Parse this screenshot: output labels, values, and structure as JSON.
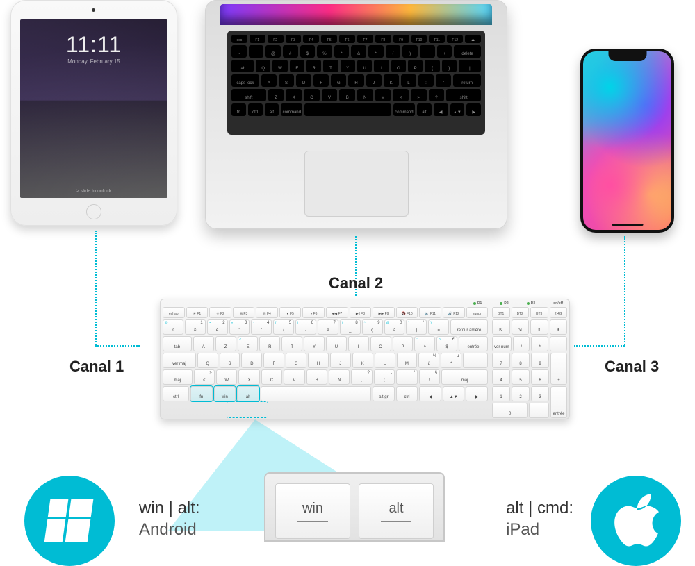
{
  "ipad": {
    "time": "11:11",
    "date": "Monday, February 15",
    "unlock": "> slide to unlock"
  },
  "macbook": {
    "keys_fn": [
      "esc",
      "F1",
      "F2",
      "F3",
      "F4",
      "F5",
      "F6",
      "F7",
      "F8",
      "F9",
      "F10",
      "F11",
      "F12",
      "⏏"
    ],
    "rows": {
      "num": [
        "~",
        "!",
        "@",
        "#",
        "$",
        "%",
        "^",
        "&",
        "*",
        "(",
        ")",
        "_",
        "+",
        "delete"
      ],
      "q": [
        "tab",
        "Q",
        "W",
        "E",
        "R",
        "T",
        "Y",
        "U",
        "I",
        "O",
        "P",
        "{",
        "}",
        "|"
      ],
      "a": [
        "caps lock",
        "A",
        "S",
        "D",
        "F",
        "G",
        "H",
        "J",
        "K",
        "L",
        ":",
        "\"",
        "return"
      ],
      "z": [
        "shift",
        "Z",
        "X",
        "C",
        "V",
        "B",
        "N",
        "M",
        "<",
        ">",
        "?",
        "shift"
      ],
      "sp": [
        "fn",
        "ctrl",
        "alt",
        "command",
        "",
        "command",
        "alt",
        "◀",
        "▲▼",
        "▶"
      ]
    }
  },
  "labels": {
    "c1": "Canal 1",
    "c2": "Canal 2",
    "c3": "Canal 3"
  },
  "white_kb": {
    "status": [
      "D1",
      "D2",
      "D3",
      "on/off"
    ],
    "fn": [
      "échap",
      "☀ F1",
      "☀ F2",
      "⊞ F3",
      "⊟ F4",
      "◐ F5",
      "◑ F6",
      "◀◀ F7",
      "▶‖ F8",
      "▶▶ F9",
      "🔇 F10",
      "🔉 F11",
      "🔊 F12",
      "suppr",
      "BT1",
      "BT2",
      "BT3",
      "2.4G"
    ],
    "r1": [
      {
        "t": "²",
        "s": "@"
      },
      {
        "t": "&",
        "n": "1"
      },
      {
        "t": "é",
        "n": "2",
        "s": "~"
      },
      {
        "t": "\"",
        "n": "3",
        "s": "#"
      },
      {
        "t": "'",
        "n": "4",
        "s": "{"
      },
      {
        "t": "(",
        "n": "5",
        "s": "["
      },
      {
        "t": "-",
        "n": "6",
        "s": "|"
      },
      {
        "t": "è",
        "n": "7",
        "s": "`"
      },
      {
        "t": "_",
        "n": "8",
        "s": "\\"
      },
      {
        "t": "ç",
        "n": "9",
        "s": "^"
      },
      {
        "t": "à",
        "n": "0",
        "s": "@"
      },
      {
        "t": ")",
        "s": "]",
        "n": "°"
      },
      {
        "t": "=",
        "s": "}",
        "n": "+"
      },
      {
        "t": "retour arrière",
        "w": "w2"
      }
    ],
    "r2": [
      {
        "t": "tab",
        "w": "w15"
      },
      {
        "t": "A"
      },
      {
        "t": "Z"
      },
      {
        "t": "E",
        "s": "€"
      },
      {
        "t": "R"
      },
      {
        "t": "T"
      },
      {
        "t": "Y"
      },
      {
        "t": "U"
      },
      {
        "t": "I"
      },
      {
        "t": "O"
      },
      {
        "t": "P"
      },
      {
        "t": "^",
        "s": "¨"
      },
      {
        "t": "$",
        "s": "¤",
        "n": "£"
      },
      {
        "t": "entrée",
        "w": "w15"
      }
    ],
    "r3": [
      {
        "t": "ver maj",
        "w": "w175"
      },
      {
        "t": "Q"
      },
      {
        "t": "S"
      },
      {
        "t": "D"
      },
      {
        "t": "F"
      },
      {
        "t": "G"
      },
      {
        "t": "H"
      },
      {
        "t": "J"
      },
      {
        "t": "K"
      },
      {
        "t": "L"
      },
      {
        "t": "M"
      },
      {
        "t": "ù",
        "n": "%"
      },
      {
        "t": "*",
        "n": "µ"
      },
      {
        "t": "",
        "w": "w125"
      }
    ],
    "r4": [
      {
        "t": "maj",
        "w": "w15"
      },
      {
        "t": "<",
        "n": ">"
      },
      {
        "t": "W"
      },
      {
        "t": "X"
      },
      {
        "t": "C"
      },
      {
        "t": "V"
      },
      {
        "t": "B"
      },
      {
        "t": "N"
      },
      {
        "t": ",",
        "n": "?"
      },
      {
        "t": ";",
        "n": "."
      },
      {
        "t": ":",
        "n": "/"
      },
      {
        "t": "!",
        "n": "§"
      },
      {
        "t": "maj",
        "w": "w25"
      }
    ],
    "r5": [
      {
        "t": "ctrl",
        "w": "w125"
      },
      {
        "t": "fn",
        "hl": true
      },
      {
        "t": "win",
        "hl": true
      },
      {
        "t": "alt",
        "hl": true
      },
      {
        "t": "",
        "w": "w6"
      },
      {
        "t": "alt gr"
      },
      {
        "t": "ctrl"
      },
      {
        "t": "◀"
      },
      {
        "t": "▲▼"
      },
      {
        "t": "▶"
      }
    ],
    "pad_row1": [
      "⇱",
      "⇲",
      "⇞",
      "⇟"
    ],
    "pad_row2": [
      "ver num",
      "/",
      "*",
      "-"
    ],
    "pad_row3": [
      "7",
      "8",
      "9"
    ],
    "pad_row4": [
      "4",
      "5",
      "6"
    ],
    "pad_row5": [
      "1",
      "2",
      "3"
    ],
    "pad_row6": [
      "0",
      ","
    ],
    "pad_plus": "+",
    "pad_enter": "entrée"
  },
  "zoom": {
    "left": "win",
    "right": "alt"
  },
  "bottom": {
    "left_line1": "win | alt:",
    "left_line2": "Android",
    "right_line1": "alt | cmd:",
    "right_line2": "iPad"
  }
}
